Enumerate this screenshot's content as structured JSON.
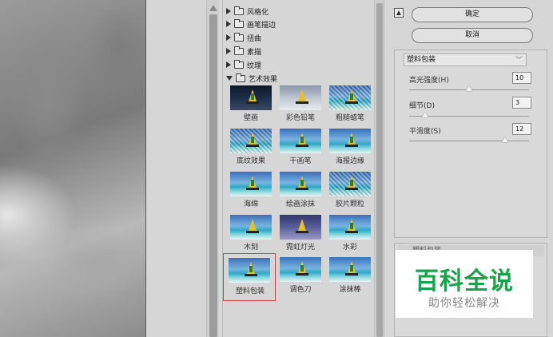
{
  "gallery": {
    "categories": [
      {
        "label": "风格化",
        "expanded": false
      },
      {
        "label": "画笔描边",
        "expanded": false
      },
      {
        "label": "扭曲",
        "expanded": false
      },
      {
        "label": "素描",
        "expanded": false
      },
      {
        "label": "纹理",
        "expanded": false
      },
      {
        "label": "艺术效果",
        "expanded": true
      }
    ],
    "filters": [
      {
        "label": "壁画"
      },
      {
        "label": "彩色铅笔"
      },
      {
        "label": "粗糙蜡笔"
      },
      {
        "label": "底纹效果"
      },
      {
        "label": "干画笔"
      },
      {
        "label": "海报边缘"
      },
      {
        "label": "海绵"
      },
      {
        "label": "绘画涂抹"
      },
      {
        "label": "胶片颗粒"
      },
      {
        "label": "木刻"
      },
      {
        "label": "霓虹灯光"
      },
      {
        "label": "水彩"
      },
      {
        "label": "塑料包装",
        "selected": true
      },
      {
        "label": "调色刀"
      },
      {
        "label": "涂抹棒"
      }
    ]
  },
  "right_panel": {
    "ok_label": "确定",
    "cancel_label": "取消",
    "collapse_icon": "double-chevron-up-icon",
    "filter_select": "塑料包装",
    "params": [
      {
        "label": "高光强度(H)",
        "value": "10",
        "fraction": 0.5
      },
      {
        "label": "细节(D)",
        "value": "3",
        "fraction": 0.13
      },
      {
        "label": "平滑度(S)",
        "value": "12",
        "fraction": 0.8
      }
    ],
    "layer_label": "塑料包装"
  },
  "watermark": {
    "title": "百科全说",
    "subtitle": "助你轻松解决"
  },
  "colors": {
    "selection_border": "#d94040",
    "watermark_green": "#1aa34a"
  }
}
